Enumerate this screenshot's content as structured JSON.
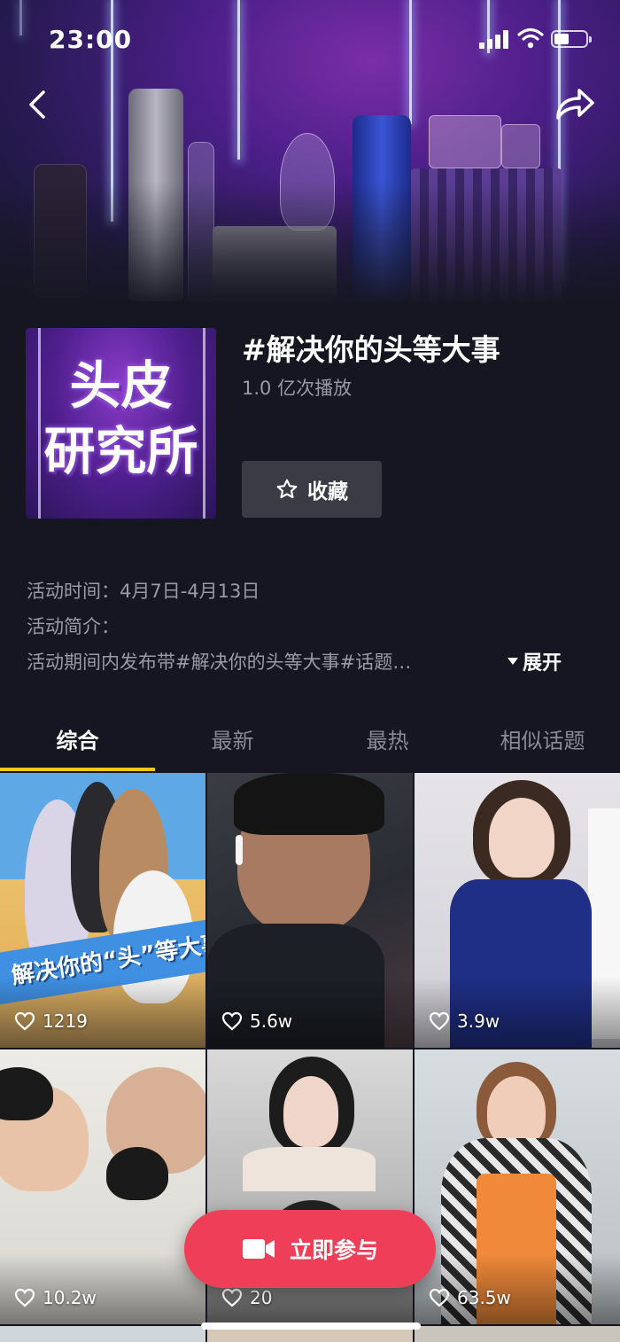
{
  "status_bar": {
    "time": "23:00"
  },
  "topic": {
    "cover_line1": "头皮",
    "cover_line2": "研究所",
    "title": "#解决你的头等大事",
    "plays": "1.0 亿次播放",
    "favorite_label": "收藏"
  },
  "activity": {
    "time": "活动时间：4月7日-4月13日",
    "intro_label": "活动简介：",
    "intro_text": "活动期间内发布带#解决你的头等大事#话题…",
    "expand_label": "展开"
  },
  "tabs": [
    {
      "label": "综合",
      "active": true
    },
    {
      "label": "最新",
      "active": false
    },
    {
      "label": "最热",
      "active": false
    },
    {
      "label": "相似话题",
      "active": false
    }
  ],
  "videos": [
    {
      "likes": "1219",
      "banner": "解决你的“头”等大事"
    },
    {
      "likes": "5.6w"
    },
    {
      "likes": "3.9w"
    },
    {
      "likes": "10.2w"
    },
    {
      "likes": "20"
    },
    {
      "likes": "63.5w"
    }
  ],
  "cta": {
    "label": "立即参与"
  },
  "colors": {
    "accent": "#ef3f58",
    "tab_indicator": "#f5c518",
    "background": "#161622"
  }
}
